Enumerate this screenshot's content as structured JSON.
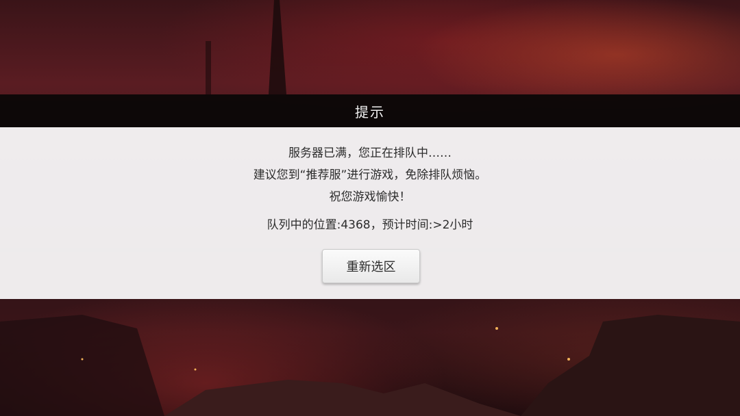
{
  "dialog": {
    "title": "提示",
    "line1": "服务器已满，您正在排队中……",
    "line2": "建议您到“推荐服”进行游戏，免除排队烦恼。",
    "line3": "祝您游戏愉快！",
    "queue_line": "队列中的位置:4368，预计时间:>2小时",
    "button_label": "重新选区"
  }
}
